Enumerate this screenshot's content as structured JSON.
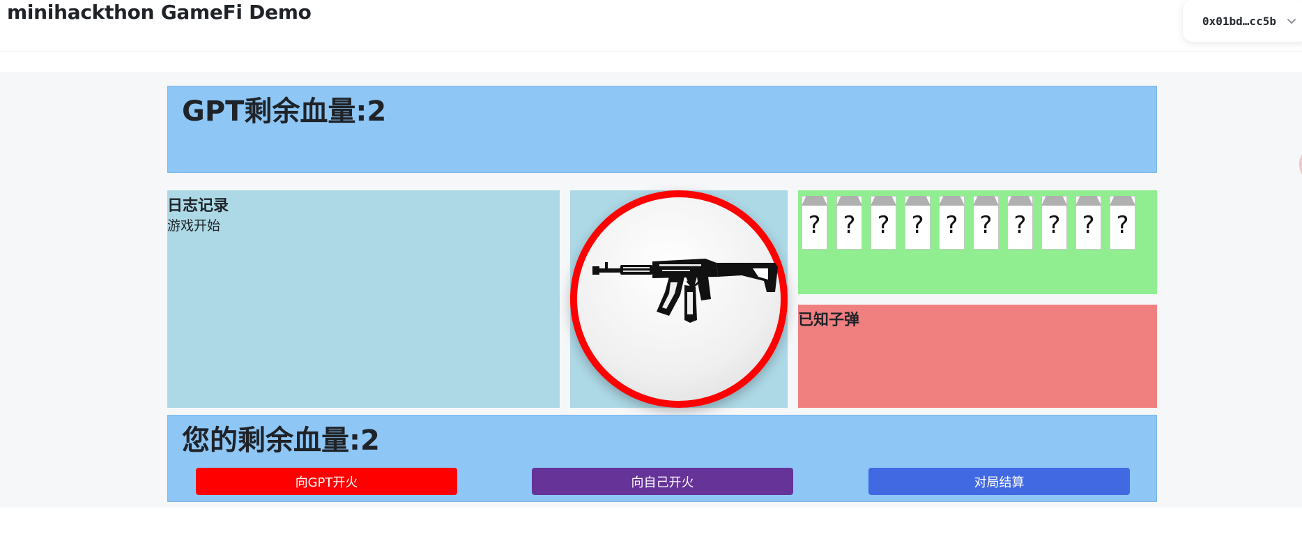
{
  "header": {
    "title": "minihackthon GameFi Demo",
    "wallet_address": "0x01bd…cc5b"
  },
  "gpt": {
    "hp_label": "GPT剩余血量:2"
  },
  "log": {
    "title": "日志记录",
    "entries": [
      "游戏开始"
    ]
  },
  "bullets": {
    "slots": [
      "?",
      "?",
      "?",
      "?",
      "?",
      "?",
      "?",
      "?",
      "?",
      "?"
    ]
  },
  "known": {
    "title": "已知子弹"
  },
  "player": {
    "hp_label": "您的剩余血量:2"
  },
  "actions": {
    "fire_gpt": "向GPT开火",
    "fire_self": "向自己开火",
    "settle": "对局结算"
  },
  "colors": {
    "hp_panel": "#8ec6f5",
    "log_panel": "#add8e6",
    "bullets_panel": "#90ee90",
    "known_panel": "#f08080",
    "gun_ring": "#ff0000",
    "fire_gpt": "#ff0000",
    "fire_self": "#663399",
    "settle": "#4169e1"
  },
  "icons": {
    "gun": "rifle-icon",
    "wallet_chevron": "chevron-down-icon"
  }
}
